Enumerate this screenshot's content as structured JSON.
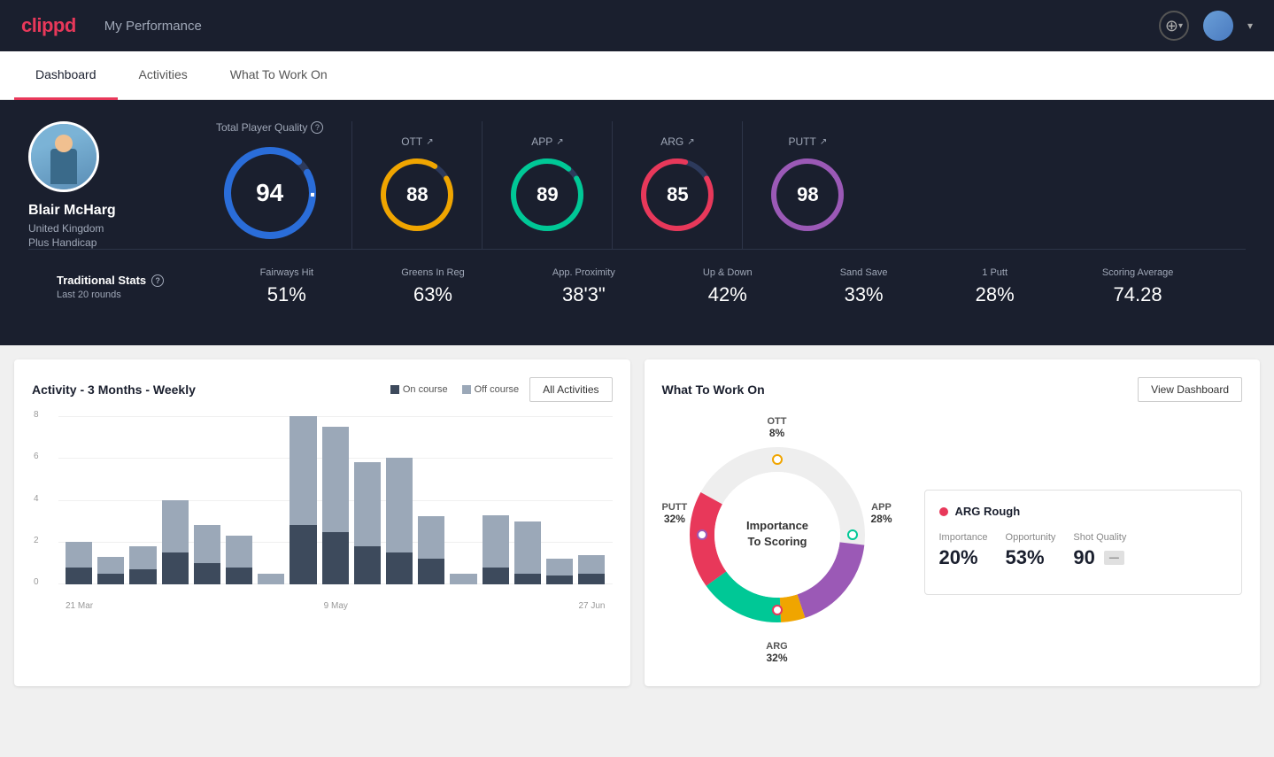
{
  "header": {
    "logo": "clippd",
    "title": "My Performance",
    "add_icon": "+",
    "avatar_chevron": "▾"
  },
  "nav": {
    "tabs": [
      {
        "id": "dashboard",
        "label": "Dashboard",
        "active": true
      },
      {
        "id": "activities",
        "label": "Activities",
        "active": false
      },
      {
        "id": "what-to-work-on",
        "label": "What To Work On",
        "active": false
      }
    ]
  },
  "player": {
    "name": "Blair McHarg",
    "country": "United Kingdom",
    "handicap": "Plus Handicap"
  },
  "quality": {
    "total_label": "Total Player Quality",
    "total_value": 94,
    "sub": [
      {
        "id": "ott",
        "label": "OTT",
        "value": 88,
        "color": "#f0a500"
      },
      {
        "id": "app",
        "label": "APP",
        "value": 89,
        "color": "#00c896"
      },
      {
        "id": "arg",
        "label": "ARG",
        "value": 85,
        "color": "#e8385a"
      },
      {
        "id": "putt",
        "label": "PUTT",
        "value": 98,
        "color": "#9b59b6"
      }
    ]
  },
  "traditional_stats": {
    "title": "Traditional Stats",
    "subtitle": "Last 20 rounds",
    "items": [
      {
        "name": "Fairways Hit",
        "value": "51%"
      },
      {
        "name": "Greens In Reg",
        "value": "63%"
      },
      {
        "name": "App. Proximity",
        "value": "38'3\""
      },
      {
        "name": "Up & Down",
        "value": "42%"
      },
      {
        "name": "Sand Save",
        "value": "33%"
      },
      {
        "name": "1 Putt",
        "value": "28%"
      },
      {
        "name": "Scoring Average",
        "value": "74.28"
      }
    ]
  },
  "activity_chart": {
    "title": "Activity - 3 Months - Weekly",
    "legend_on_course": "On course",
    "legend_off_course": "Off course",
    "all_activities_btn": "All Activities",
    "y_labels": [
      "8",
      "6",
      "4",
      "2",
      "0"
    ],
    "x_labels": [
      "21 Mar",
      "9 May",
      "27 Jun"
    ],
    "bars": [
      {
        "on": 0.8,
        "off": 1.2
      },
      {
        "on": 0.5,
        "off": 0.8
      },
      {
        "on": 0.7,
        "off": 1.1
      },
      {
        "on": 1.5,
        "off": 2.5
      },
      {
        "on": 1.0,
        "off": 1.8
      },
      {
        "on": 0.8,
        "off": 1.5
      },
      {
        "on": 0.0,
        "off": 0.5
      },
      {
        "on": 3.0,
        "off": 5.5
      },
      {
        "on": 2.5,
        "off": 5.0
      },
      {
        "on": 1.8,
        "off": 4.0
      },
      {
        "on": 1.5,
        "off": 4.5
      },
      {
        "on": 1.2,
        "off": 2.0
      },
      {
        "on": 0.0,
        "off": 0.5
      },
      {
        "on": 0.8,
        "off": 2.5
      },
      {
        "on": 0.5,
        "off": 2.5
      },
      {
        "on": 0.4,
        "off": 0.8
      },
      {
        "on": 0.5,
        "off": 0.9
      }
    ]
  },
  "what_to_work_on": {
    "title": "What To Work On",
    "view_dashboard_btn": "View Dashboard",
    "donut_center_line1": "Importance",
    "donut_center_line2": "To Scoring",
    "segments": [
      {
        "label": "OTT",
        "percent": "8%",
        "color": "#f0a500",
        "position": "top"
      },
      {
        "label": "APP",
        "percent": "28%",
        "color": "#00c896",
        "position": "right"
      },
      {
        "label": "ARG",
        "percent": "32%",
        "color": "#e8385a",
        "position": "bottom"
      },
      {
        "label": "PUTT",
        "percent": "32%",
        "color": "#9b59b6",
        "position": "left"
      }
    ],
    "info_card": {
      "title": "ARG Rough",
      "importance_label": "Importance",
      "importance_value": "20%",
      "opportunity_label": "Opportunity",
      "opportunity_value": "53%",
      "shot_quality_label": "Shot Quality",
      "shot_quality_value": "90"
    }
  }
}
